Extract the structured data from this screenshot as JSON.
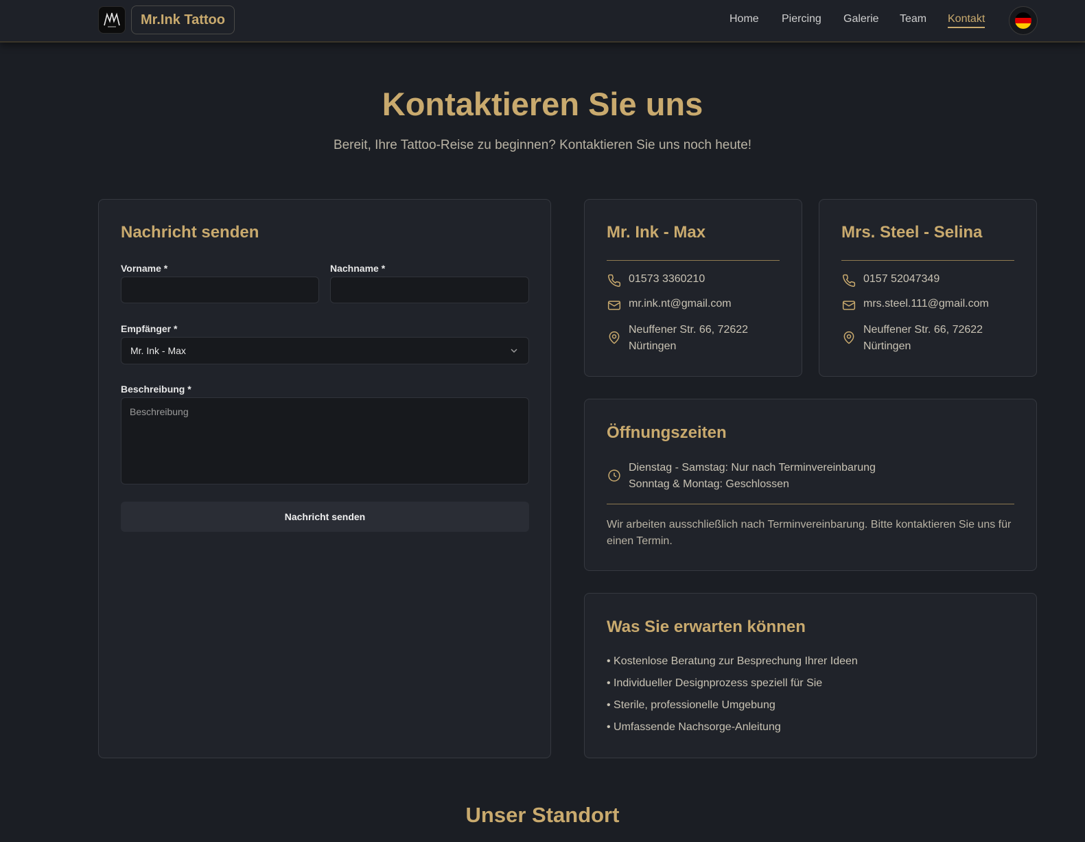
{
  "nav": {
    "brand": "Mr.Ink Tattoo",
    "links": [
      "Home",
      "Piercing",
      "Galerie",
      "Team",
      "Kontakt"
    ],
    "active": "Kontakt",
    "language": "de"
  },
  "hero": {
    "title": "Kontaktieren Sie uns",
    "subtitle": "Bereit, Ihre Tattoo-Reise zu beginnen? Kontaktieren Sie uns noch heute!"
  },
  "form": {
    "title": "Nachricht senden",
    "first_name_label": "Vorname *",
    "first_name_value": "",
    "last_name_label": "Nachname *",
    "last_name_value": "",
    "recipient_label": "Empfänger *",
    "recipient_value": "Mr. Ink - Max",
    "description_label": "Beschreibung *",
    "description_placeholder": "Beschreibung",
    "submit_label": "Nachricht senden"
  },
  "contacts": [
    {
      "name": "Mr. Ink - Max",
      "phone": "01573 3360210",
      "email": "mr.ink.nt@gmail.com",
      "address_line1": "Neuffener Str. 66, 72622",
      "address_line2": "Nürtingen"
    },
    {
      "name": "Mrs. Steel - Selina",
      "phone": "0157 52047349",
      "email": "mrs.steel.111@gmail.com",
      "address_line1": "Neuffener Str. 66, 72622",
      "address_line2": "Nürtingen"
    }
  ],
  "hours": {
    "title": "Öffnungszeiten",
    "line1": "Dienstag - Samstag: Nur nach Terminvereinbarung",
    "line2": "Sonntag & Montag: Geschlossen",
    "note": "Wir arbeiten ausschließlich nach Terminvereinbarung. Bitte kontaktieren Sie uns für einen Termin."
  },
  "expect": {
    "title": "Was Sie erwarten können",
    "items": [
      "• Kostenlose Beratung zur Besprechung Ihrer Ideen",
      "• Individueller Designprozess speziell für Sie",
      "• Sterile, professionelle Umgebung",
      "• Umfassende Nachsorge-Anleitung"
    ]
  },
  "location": {
    "title": "Unser Standort"
  },
  "colors": {
    "accent": "#c9aa6e",
    "background": "#1b1e24",
    "card": "#20232a"
  },
  "icons": [
    "logo-icon",
    "flag-de-icon",
    "chevron-down-icon",
    "phone-icon",
    "mail-icon",
    "map-pin-icon",
    "clock-icon"
  ]
}
